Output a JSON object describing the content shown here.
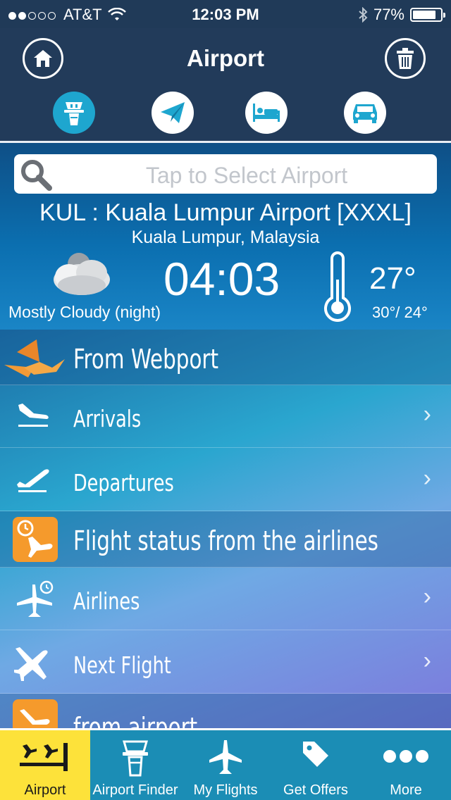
{
  "status_bar": {
    "carrier": "AT&T",
    "time": "12:03 PM",
    "battery": "77%",
    "battery_level": 0.77
  },
  "navbar": {
    "title": "Airport"
  },
  "search": {
    "placeholder": "Tap to Select Airport"
  },
  "airport": {
    "name": "KUL : Kuala Lumpur Airport [XXXL]",
    "location": "Kuala Lumpur, Malaysia",
    "local_time": "04:03",
    "condition": "Mostly Cloudy (night)",
    "temperature": "27°",
    "high_low": "30°/ 24°"
  },
  "list": {
    "section_webport": "From Webport",
    "arrivals": "Arrivals",
    "departures": "Departures",
    "section_airlines": "Flight status from the airlines",
    "airlines": "Airlines",
    "next_flight": "Next Flight",
    "section_airport": "from airport"
  },
  "tabs": [
    {
      "label": "Airport"
    },
    {
      "label": "Airport Finder"
    },
    {
      "label": "My Flights"
    },
    {
      "label": "Get Offers"
    },
    {
      "label": "More"
    }
  ],
  "colors": {
    "accent": "#1ea6cf",
    "active_tab": "#fde23a",
    "orange": "#f59a2c"
  }
}
